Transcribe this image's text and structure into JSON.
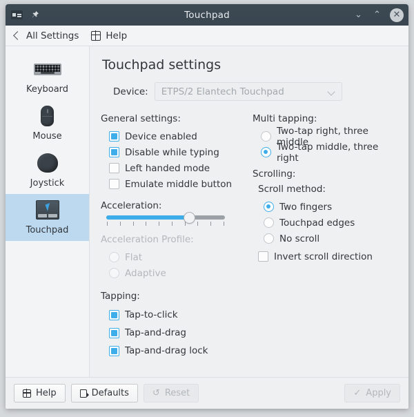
{
  "window": {
    "title": "Touchpad",
    "menu_icon": "window-menu-icon",
    "pin_icon": "pin-icon",
    "minimize_label": "⌄",
    "maximize_label": "⌃",
    "close_label": "✕"
  },
  "toolbar": {
    "back_label": "All Settings",
    "back_icon": "chevron-left-icon",
    "help_label": "Help",
    "help_icon": "help-grid-icon"
  },
  "sidebar": {
    "items": [
      {
        "label": "Keyboard",
        "icon": "keyboard-icon",
        "selected": false
      },
      {
        "label": "Mouse",
        "icon": "mouse-icon",
        "selected": false
      },
      {
        "label": "Joystick",
        "icon": "joystick-icon",
        "selected": false
      },
      {
        "label": "Touchpad",
        "icon": "touchpad-icon",
        "selected": true
      }
    ]
  },
  "main": {
    "page_title": "Touchpad settings",
    "device": {
      "label": "Device:",
      "value": "ETPS/2 Elantech Touchpad",
      "enabled": false,
      "chevron_icon": "chevron-down-icon"
    },
    "general": {
      "heading": "General settings:",
      "checkboxes": [
        {
          "label": "Device enabled",
          "checked": true
        },
        {
          "label": "Disable while typing",
          "checked": true
        },
        {
          "label": "Left handed mode",
          "checked": false
        },
        {
          "label": "Emulate middle button",
          "checked": false
        }
      ]
    },
    "acceleration": {
      "heading": "Acceleration:",
      "value_percent": 70,
      "tick_count": 10
    },
    "acceleration_profile": {
      "heading": "Acceleration Profile:",
      "enabled": false,
      "options": [
        {
          "label": "Flat",
          "selected": false
        },
        {
          "label": "Adaptive",
          "selected": false
        }
      ]
    },
    "tapping": {
      "heading": "Tapping:",
      "checkboxes": [
        {
          "label": "Tap-to-click",
          "checked": true
        },
        {
          "label": "Tap-and-drag",
          "checked": true
        },
        {
          "label": "Tap-and-drag lock",
          "checked": true
        }
      ]
    },
    "multi_tapping": {
      "heading": "Multi tapping:",
      "options": [
        {
          "label": "Two-tap right, three middle",
          "selected": false
        },
        {
          "label": "Two-tap middle, three right",
          "selected": true
        }
      ]
    },
    "scrolling": {
      "heading": "Scrolling:",
      "method_heading": "Scroll method:",
      "options": [
        {
          "label": "Two fingers",
          "selected": true
        },
        {
          "label": "Touchpad edges",
          "selected": false
        },
        {
          "label": "No scroll",
          "selected": false
        }
      ],
      "invert": {
        "label": "Invert scroll direction",
        "checked": false
      }
    }
  },
  "footer": {
    "buttons": [
      {
        "label": "Help",
        "icon": "help-grid-icon",
        "enabled": true
      },
      {
        "label": "Defaults",
        "icon": "defaults-icon",
        "enabled": true
      },
      {
        "label": "Reset",
        "icon": "↺",
        "enabled": false
      },
      {
        "label": "Apply",
        "icon": "✓",
        "enabled": false
      }
    ]
  },
  "colors": {
    "accent": "#3daee9",
    "selection": "#bcd9ef",
    "titlebar": "#3d4952",
    "background": "#eff0f1"
  }
}
